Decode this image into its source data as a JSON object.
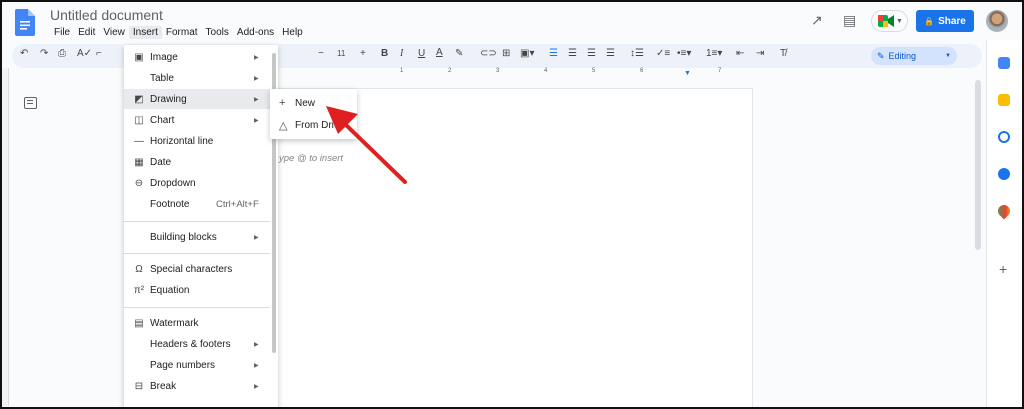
{
  "app": {
    "title": "Untitled document"
  },
  "menubar": [
    "File",
    "Edit",
    "View",
    "Insert",
    "Format",
    "Tools",
    "Add-ons",
    "Help"
  ],
  "header": {
    "share_label": "Share",
    "lock_icon": "🔒"
  },
  "toolbar": {
    "font_size": "11",
    "editing_label": "Editing"
  },
  "ruler": [
    "1",
    "2",
    "3",
    "4",
    "5",
    "6",
    "7"
  ],
  "doc": {
    "placeholder": "ype @ to insert"
  },
  "insert_menu": {
    "items": [
      {
        "label": "Image",
        "icon": "▣",
        "arrow": "▶"
      },
      {
        "label": "Table",
        "icon": "",
        "arrow": "▶"
      },
      {
        "label": "Drawing",
        "icon": "◩",
        "arrow": "▶"
      },
      {
        "label": "Chart",
        "icon": "◫",
        "arrow": "▶"
      },
      {
        "label": "Horizontal line",
        "icon": "—",
        "arrow": ""
      },
      {
        "label": "Date",
        "icon": "▦",
        "arrow": ""
      },
      {
        "label": "Dropdown",
        "icon": "⊖",
        "arrow": ""
      },
      {
        "label": "Footnote",
        "icon": "",
        "arrow": "",
        "shortcut": "Ctrl+Alt+F"
      },
      {
        "label": "Building blocks",
        "icon": "",
        "arrow": "▶"
      },
      {
        "label": "Special characters",
        "icon": "Ω",
        "arrow": ""
      },
      {
        "label": "Equation",
        "icon": "π²",
        "arrow": ""
      },
      {
        "label": "Watermark",
        "icon": "▤",
        "arrow": ""
      },
      {
        "label": "Headers & footers",
        "icon": "",
        "arrow": "▶"
      },
      {
        "label": "Page numbers",
        "icon": "",
        "arrow": "▶"
      },
      {
        "label": "Break",
        "icon": "⊟",
        "arrow": "▶"
      }
    ]
  },
  "drawing_submenu": {
    "items": [
      {
        "label": "New",
        "icon": "+"
      },
      {
        "label": "From Dri",
        "icon": "△"
      }
    ]
  },
  "colors": {
    "accent": "#1a73e8",
    "arrow": "#e02020"
  }
}
